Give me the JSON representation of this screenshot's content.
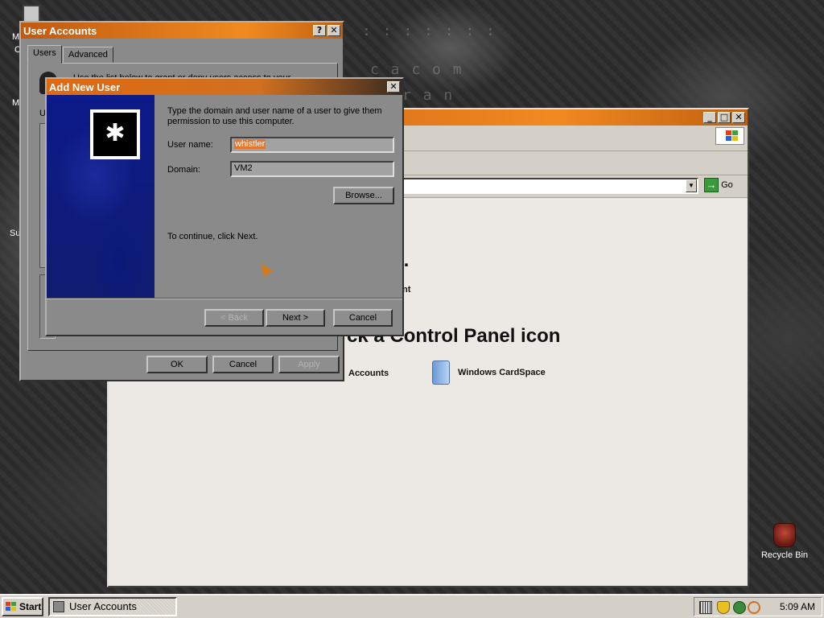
{
  "desktop": {
    "recycle_bin_label": "Recycle Bin",
    "left_edge_labels": [
      "M",
      "C",
      "M",
      "Su"
    ]
  },
  "control_panel": {
    "address_go": "Go",
    "heading_partial_1": "k...",
    "heading_partial_2": "ck a Control Panel icon",
    "link_partial": "nt",
    "items": [
      {
        "label": "Accounts",
        "icon": "user-accounts-icon"
      },
      {
        "label": "Windows CardSpace",
        "icon": "windows-cardspace-icon"
      }
    ]
  },
  "user_accounts": {
    "title": "User Accounts",
    "tabs": [
      "Users",
      "Advanced"
    ],
    "intro_partial": "Use the list below to grant or deny users access to your",
    "list_label_partial": "U",
    "buttons": {
      "ok": "OK",
      "cancel": "Cancel",
      "apply": "Apply"
    }
  },
  "add_new_user": {
    "title": "Add New User",
    "instructions": "Type the domain and user name of a user to give them permission to use this computer.",
    "username_label": "User name:",
    "username_value": "whistler",
    "domain_label": "Domain:",
    "domain_value": "VM2",
    "browse_label": "Browse...",
    "continue_text": "To continue, click Next.",
    "buttons": {
      "back": "< Back",
      "next": "Next >",
      "cancel": "Cancel"
    }
  },
  "taskbar": {
    "start_label": "Start",
    "task_label": "User Accounts",
    "clock": "5:09 AM"
  },
  "colors": {
    "titlebar_orange": "#f08a20",
    "selection_orange": "#e8762a",
    "dialog_blue": "#0c1a8a"
  }
}
